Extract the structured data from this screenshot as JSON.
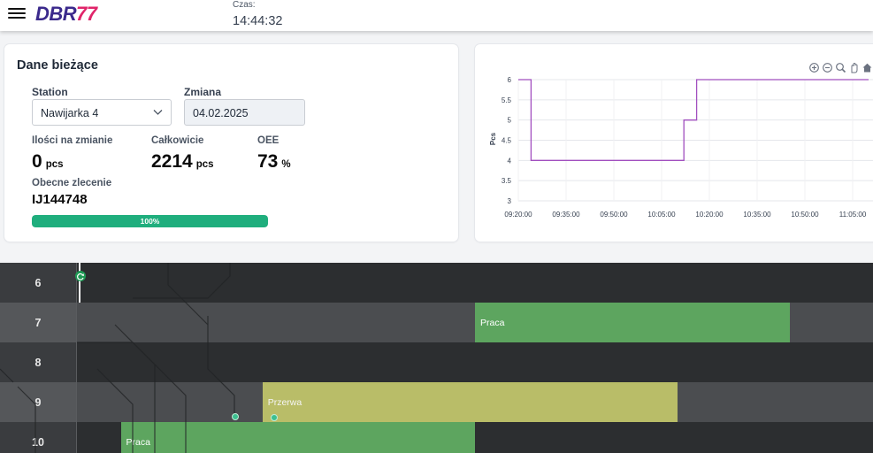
{
  "header": {
    "logo_text": "DBR77",
    "time_label": "Czas:",
    "time_value": "14:44:32"
  },
  "current": {
    "title": "Dane bieżące",
    "station_label": "Station",
    "station_value": "Nawijarka 4",
    "shift_label": "Zmiana",
    "shift_value": "04.02.2025",
    "qty_label": "Ilości na zmianie",
    "qty_value": "0",
    "qty_unit": "pcs",
    "total_label": "Całkowicie",
    "total_value": "2214",
    "total_unit": "pcs",
    "oee_label": "OEE",
    "oee_value": "73",
    "oee_unit": "%",
    "order_label": "Obecne zlecenie",
    "order_value": "IJ144748",
    "progress_text": "100%",
    "progress_value": 1.0,
    "progress_color": "#1fae7d"
  },
  "chart_data": {
    "type": "line",
    "ylabel": "Pcs",
    "xlabel": "",
    "ylim": [
      3,
      6
    ],
    "yticks": [
      "3",
      "3.5",
      "4",
      "4.5",
      "5",
      "5.5",
      "6"
    ],
    "xticks": [
      "09:20:00",
      "09:35:00",
      "09:50:00",
      "10:05:00",
      "10:20:00",
      "10:35:00",
      "10:50:00",
      "11:05:00"
    ],
    "xlim_minutes_from_first_tick": [
      0,
      105
    ],
    "grid": true,
    "series": [
      {
        "color": "#a14fbf",
        "step": true,
        "x": [
          0,
          4,
          4,
          52,
          52,
          56,
          56,
          110
        ],
        "y": [
          6,
          6,
          4,
          4,
          5,
          5,
          6,
          6
        ]
      }
    ],
    "toolbar_icons": [
      "zoom-in-icon",
      "zoom-out-icon",
      "magnify-icon",
      "pan-icon",
      "home-icon"
    ]
  },
  "timeline": {
    "rows": [
      {
        "hour": "6"
      },
      {
        "hour": "7"
      },
      {
        "hour": "8"
      },
      {
        "hour": "9"
      },
      {
        "hour": "10"
      }
    ],
    "bars": [
      {
        "row": 1,
        "label": "Praca",
        "kind": "work",
        "start": 0.5,
        "end": 0.895
      },
      {
        "row": 3,
        "label": "Przerwa",
        "kind": "pause",
        "start": 0.233,
        "end": 0.755
      },
      {
        "row": 4,
        "label": "Praca",
        "kind": "work",
        "start": 0.055,
        "end": 0.5
      }
    ],
    "colors": {
      "work": "#5da55f",
      "pause": "#b9bd68"
    }
  }
}
